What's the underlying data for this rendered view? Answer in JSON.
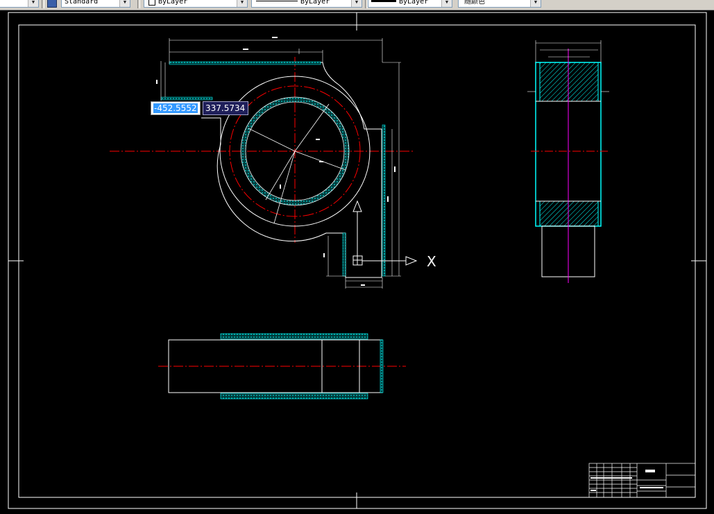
{
  "toolbar": {
    "text_style": "Standard",
    "layer_color": "ByLayer",
    "linetype": "ByLayer",
    "lineweight": "ByLayer",
    "plot_style": "随颜色"
  },
  "coordinate_input": {
    "x_value": "-452.5552",
    "y_value": "337.5734"
  },
  "ucs_icon": {
    "x_label": "X"
  },
  "colors": {
    "background": "#000000",
    "geometry": "#ffffff",
    "centerline": "#ff0000",
    "hatch": "#00ffff",
    "axis": "#ff00ff"
  }
}
